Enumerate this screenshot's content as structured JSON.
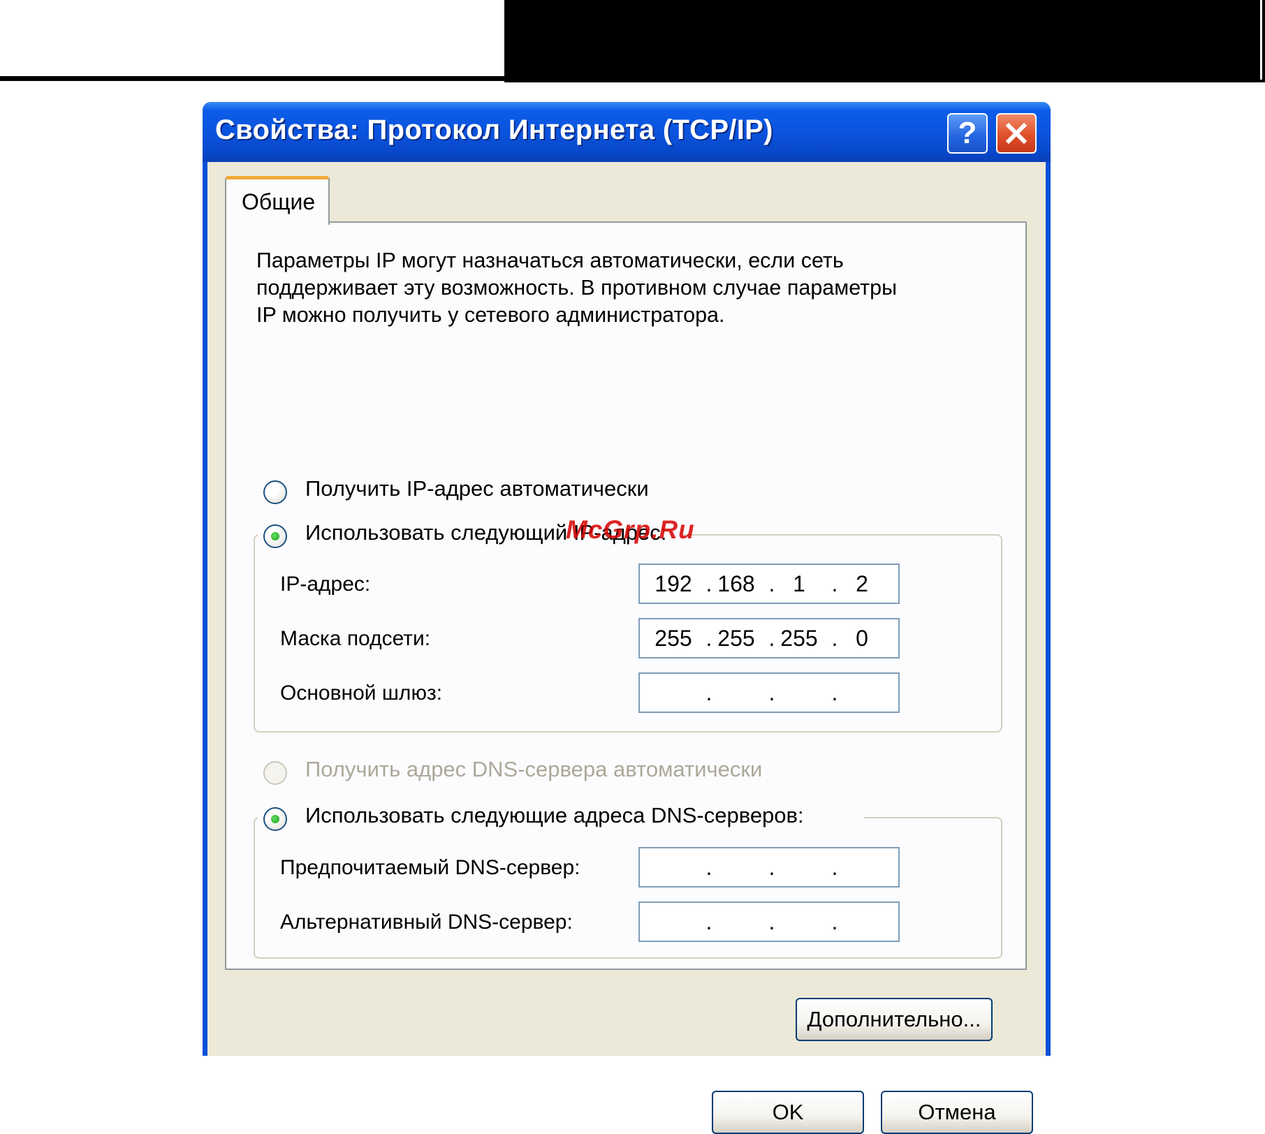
{
  "window": {
    "title": "Свойства: Протокол Интернета (TCP/IP)",
    "help_glyph": "?",
    "icons": {
      "help": "help-icon",
      "close": "close-x-icon"
    }
  },
  "tabs": [
    {
      "label": "Общие",
      "active": true
    }
  ],
  "description": "Параметры IP могут назначаться автоматически, если сеть\nподдерживает эту возможность. В противном случае параметры\nIP можно получить у сетевого администратора.",
  "ip_settings": {
    "auto_ip_label": "Получить IP-адрес автоматически",
    "auto_ip_selected": false,
    "manual_ip_label": "Использовать следующий IP-адрес:",
    "manual_ip_selected": true,
    "fields": [
      {
        "label": "IP-адрес:",
        "octets": [
          "192",
          "168",
          "1",
          "2"
        ]
      },
      {
        "label": "Маска подсети:",
        "octets": [
          "255",
          "255",
          "255",
          "0"
        ]
      },
      {
        "label": "Основной шлюз:",
        "octets": [
          "",
          "",
          "",
          ""
        ]
      }
    ]
  },
  "dns_settings": {
    "auto_dns_label": "Получить адрес DNS-сервера автоматически",
    "auto_dns_enabled": false,
    "manual_dns_label": "Использовать следующие адреса DNS-серверов:",
    "manual_dns_selected": true,
    "fields": [
      {
        "label": "Предпочитаемый DNS-сервер:",
        "octets": [
          "",
          "",
          "",
          ""
        ]
      },
      {
        "label": "Альтернативный DNS-сервер:",
        "octets": [
          "",
          "",
          "",
          ""
        ]
      }
    ]
  },
  "buttons": {
    "advanced": "Дополнительно...",
    "ok": "OK",
    "cancel": "Отмена"
  },
  "watermark": "McGrp.Ru",
  "colors": {
    "titlebar": "#0a52dc",
    "dialog_bg": "#ece9d8",
    "tab_accent": "#f2a938",
    "radio_dot": "#21a121",
    "watermark": "#d60000"
  }
}
